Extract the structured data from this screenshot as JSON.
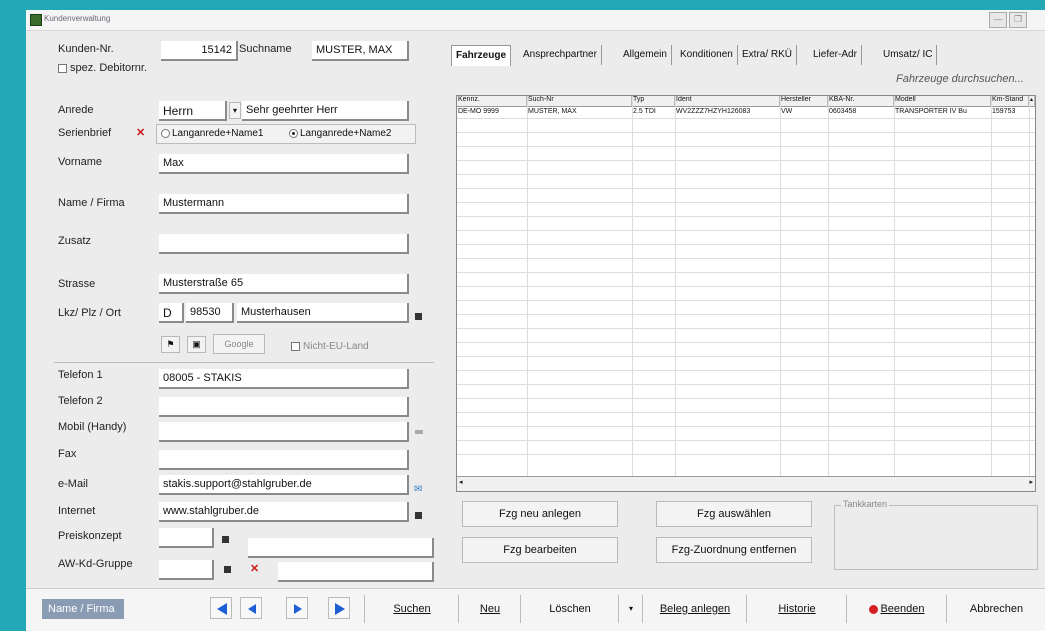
{
  "window": {
    "title": "Kundenverwaltung",
    "controls": {
      "minimize": "—",
      "restore": "❐"
    }
  },
  "customer": {
    "kunden_nr_label": "Kunden-Nr.",
    "kunden_nr": "15142",
    "suchname_label": "Suchname",
    "suchname": "MUSTER, MAX",
    "spez_debitor_label": "spez. Debitornr.",
    "anrede_label": "Anrede",
    "anrede": "Herrn",
    "anrede_text": "Sehr geehrter Herr",
    "serienbrief_label": "Serienbrief",
    "serienbrief_option1": "Langanrede+Name1",
    "serienbrief_option2": "Langanrede+Name2",
    "vorname_label": "Vorname",
    "vorname": "Max",
    "name_label": "Name / Firma",
    "name": "Mustermann",
    "zusatz_label": "Zusatz",
    "zusatz": "",
    "strasse_label": "Strasse",
    "strasse": "Musterstraße 65",
    "lkz_label": "Lkz/ Plz / Ort",
    "lkz": "D",
    "plz": "98530",
    "ort": "Musterhausen",
    "google_label": "Google",
    "nicht_eu_label": "Nicht-EU-Land",
    "telefon1_label": "Telefon 1",
    "telefon1": "08005 - STAKIS",
    "telefon2_label": "Telefon 2",
    "telefon2": "",
    "mobil_label": "Mobil (Handy)",
    "mobil": "",
    "fax_label": "Fax",
    "fax": "",
    "email_label": "e-Mail",
    "email": "stakis.support@stahlgruber.de",
    "internet_label": "Internet",
    "internet": "www.stahlgruber.de",
    "preiskonzept_label": "Preiskonzept",
    "awkd_label": "AW-Kd-Gruppe"
  },
  "tabs": [
    "Fahrzeuge",
    "Ansprechpartner",
    "Allgemein",
    "Konditionen",
    "Extra/ RKÜ",
    "Liefer-Adr",
    "Umsatz/ IC"
  ],
  "search_hint": "Fahrzeuge durchsuchen...",
  "vehicle_grid": {
    "columns": [
      "Kennz.",
      "Such-Nr",
      "Typ",
      "Ident",
      "Hersteller",
      "KBA-Nr.",
      "Modell",
      "Km-Stand"
    ],
    "rows": [
      [
        "DE-MO 9999",
        "MUSTER, MAX",
        "2.5 TDI",
        "WV2ZZZ7HZYH126083",
        "VW",
        "0603458",
        "TRANSPORTER IV Bu",
        "159753"
      ]
    ]
  },
  "vehicle_buttons": {
    "neu": "Fzg neu anlegen",
    "auswaehlen": "Fzg auswählen",
    "bearbeiten": "Fzg bearbeiten",
    "zuordnung": "Fzg-Zuordnung entfernen"
  },
  "tankkarten_label": "Tankkarten",
  "bottom_bar": {
    "sort_field": "Name / Firma",
    "suchen": "Suchen",
    "neu": "Neu",
    "loeschen": "Löschen",
    "beleg": "Beleg anlegen",
    "historie": "Historie",
    "beenden": "Beenden",
    "abbrechen": "Abbrechen"
  }
}
